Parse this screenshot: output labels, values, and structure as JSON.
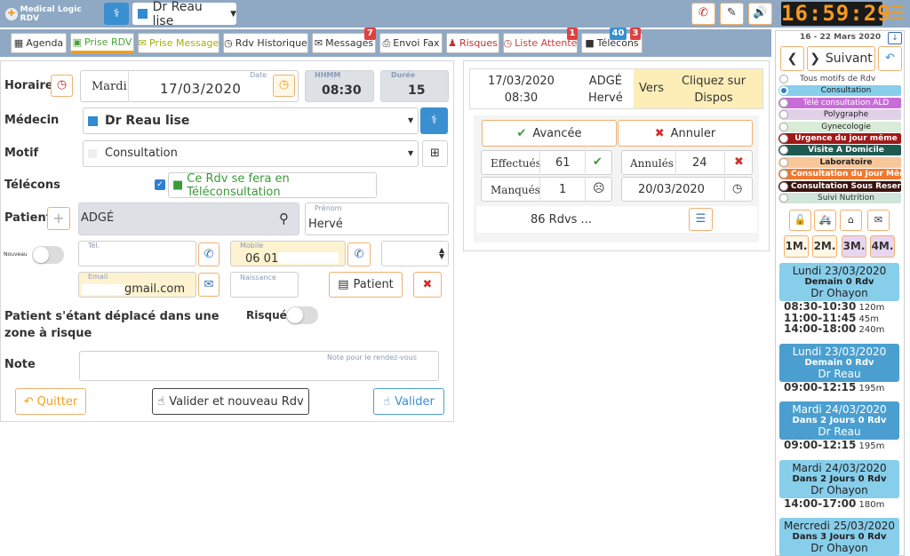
{
  "header": {
    "logo_text": "Medical Logic RDV",
    "doctor_select": "Dr Reau lise",
    "clock": "16:59:29"
  },
  "tabs": [
    {
      "label": "Agenda",
      "icon": "calendar-icon"
    },
    {
      "label": "Prise RDV",
      "icon": "calendar-plus-icon"
    },
    {
      "label": "Prise Message",
      "icon": "envelope-open-icon"
    },
    {
      "label": "Rdv Historique",
      "icon": "clock-icon"
    },
    {
      "label": "Messages",
      "icon": "envelope-icon",
      "badge": "7"
    },
    {
      "label": "Envoi Fax",
      "icon": "fax-icon"
    },
    {
      "label": "Risques",
      "icon": "user-icon"
    },
    {
      "label": "Liste Attente",
      "icon": "clock-icon",
      "badge": "1"
    },
    {
      "label": "Télécons",
      "icon": "video-icon",
      "badge": "3",
      "badge2": "40"
    }
  ],
  "form": {
    "horaire_label": "Horaire",
    "day": "Mardi",
    "date_label": "Date",
    "date": "17/03/2020",
    "hhmm_label": "HHMM",
    "time": "08:30",
    "duree_label": "Durée",
    "duree": "15",
    "medecin_label": "Médecin",
    "medecin_value": "Dr Reau lise",
    "motif_label": "Motif",
    "motif_value": "Consultation",
    "telecons_label": "Télécons",
    "telecons_text": "Ce Rdv se fera en Téléconsultation",
    "patient_label": "Patient",
    "patient_name": "ADGÉ",
    "prenom_label": "Prénom",
    "prenom": "Hervé",
    "nouveau_label": "Nouveau",
    "tel_label": "Tél.",
    "mobile_label": "Mobile",
    "mobile": "06 01",
    "email_label": "Email",
    "email": "gmail.com",
    "naissance_label": "Naissance",
    "patient_btn": "Patient",
    "risk_label": "Patient s'étant déplacé dans une zone à risque",
    "risque_label": "Risqué",
    "note_label": "Note",
    "note_placeholder": "Note pour le rendez-vous",
    "quitter": "Quitter",
    "valider_nouveau": "Valider et nouveau Rdv",
    "valider": "Valider"
  },
  "summary": {
    "date": "17/03/2020",
    "time": "08:30",
    "nom": "ADGÉ",
    "prenom": "Hervé",
    "vers": "Vers",
    "dispos": "Cliquez sur Dispos",
    "avancee": "Avancée",
    "annuler": "Annuler",
    "effectues_label": "Effectués",
    "effectues": "61",
    "annules_label": "Annulés",
    "annules": "24",
    "manques_label": "Manqués",
    "manques": "1",
    "last_date": "20/03/2020",
    "rdvs": "86 Rdvs ..."
  },
  "sidebar": {
    "week": "16 - 22 Mars 2020",
    "suivant": "Suivant",
    "motifs": [
      {
        "label": "Tous motifs de Rdv",
        "color": "#ffffff",
        "text": "#444444"
      },
      {
        "label": "Consultation",
        "color": "#87ceeb",
        "text": "#1a1a1a"
      },
      {
        "label": "Télé consultation ALD",
        "color": "#c86dd7",
        "text": "#ffffff"
      },
      {
        "label": "Polygraphe",
        "color": "#e0d0e8",
        "text": "#222222"
      },
      {
        "label": "Gynecologie",
        "color": "#d8ecd8",
        "text": "#222222"
      },
      {
        "label": "Urgence du jour même",
        "color": "#a01818",
        "text": "#ffffff"
      },
      {
        "label": "Visite A Domicile",
        "color": "#1e5a50",
        "text": "#ffffff"
      },
      {
        "label": "Laboratoire",
        "color": "#f7c79a",
        "text": "#222222"
      },
      {
        "label": "Consultation du Jour Même",
        "color": "#ee7a30",
        "text": "#ffffff"
      },
      {
        "label": "Consultation Sous Reserve",
        "color": "#3a1410",
        "text": "#ffffff"
      },
      {
        "label": "Suivi Nutrition",
        "color": "#d0e6d8",
        "text": "#333333"
      }
    ],
    "months": [
      "1M.",
      "2M.",
      "3M.",
      "4M."
    ],
    "rdvs": [
      {
        "day": "Lundi 23/03/2020",
        "delay": "Demain 0 Rdv",
        "doctor": "Dr Ohayon",
        "slots": [
          [
            "08:30-10:30",
            "120m"
          ],
          [
            "11:00-11:45",
            "45m"
          ],
          [
            "14:00-18:00",
            "240m"
          ]
        ],
        "color": "#87ceeb"
      },
      {
        "day": "Lundi 23/03/2020",
        "delay": "Demain 0 Rdv",
        "doctor": "Dr Reau",
        "slots": [
          [
            "09:00-12:15",
            "195m"
          ]
        ],
        "color": "#4a9fd0"
      },
      {
        "day": "Mardi 24/03/2020",
        "delay": "Dans 2 Jours 0 Rdv",
        "doctor": "Dr Reau",
        "slots": [
          [
            "09:00-12:15",
            "195m"
          ]
        ],
        "color": "#4a9fd0"
      },
      {
        "day": "Mardi 24/03/2020",
        "delay": "Dans 2 Jours 0 Rdv",
        "doctor": "Dr Ohayon",
        "slots": [
          [
            "14:00-17:00",
            "180m"
          ]
        ],
        "color": "#87ceeb"
      },
      {
        "day": "Mercredi 25/03/2020",
        "delay": "Dans 3 Jours 0 Rdv",
        "doctor": "Dr Ohayon",
        "slots": [],
        "color": "#87ceeb"
      }
    ]
  }
}
